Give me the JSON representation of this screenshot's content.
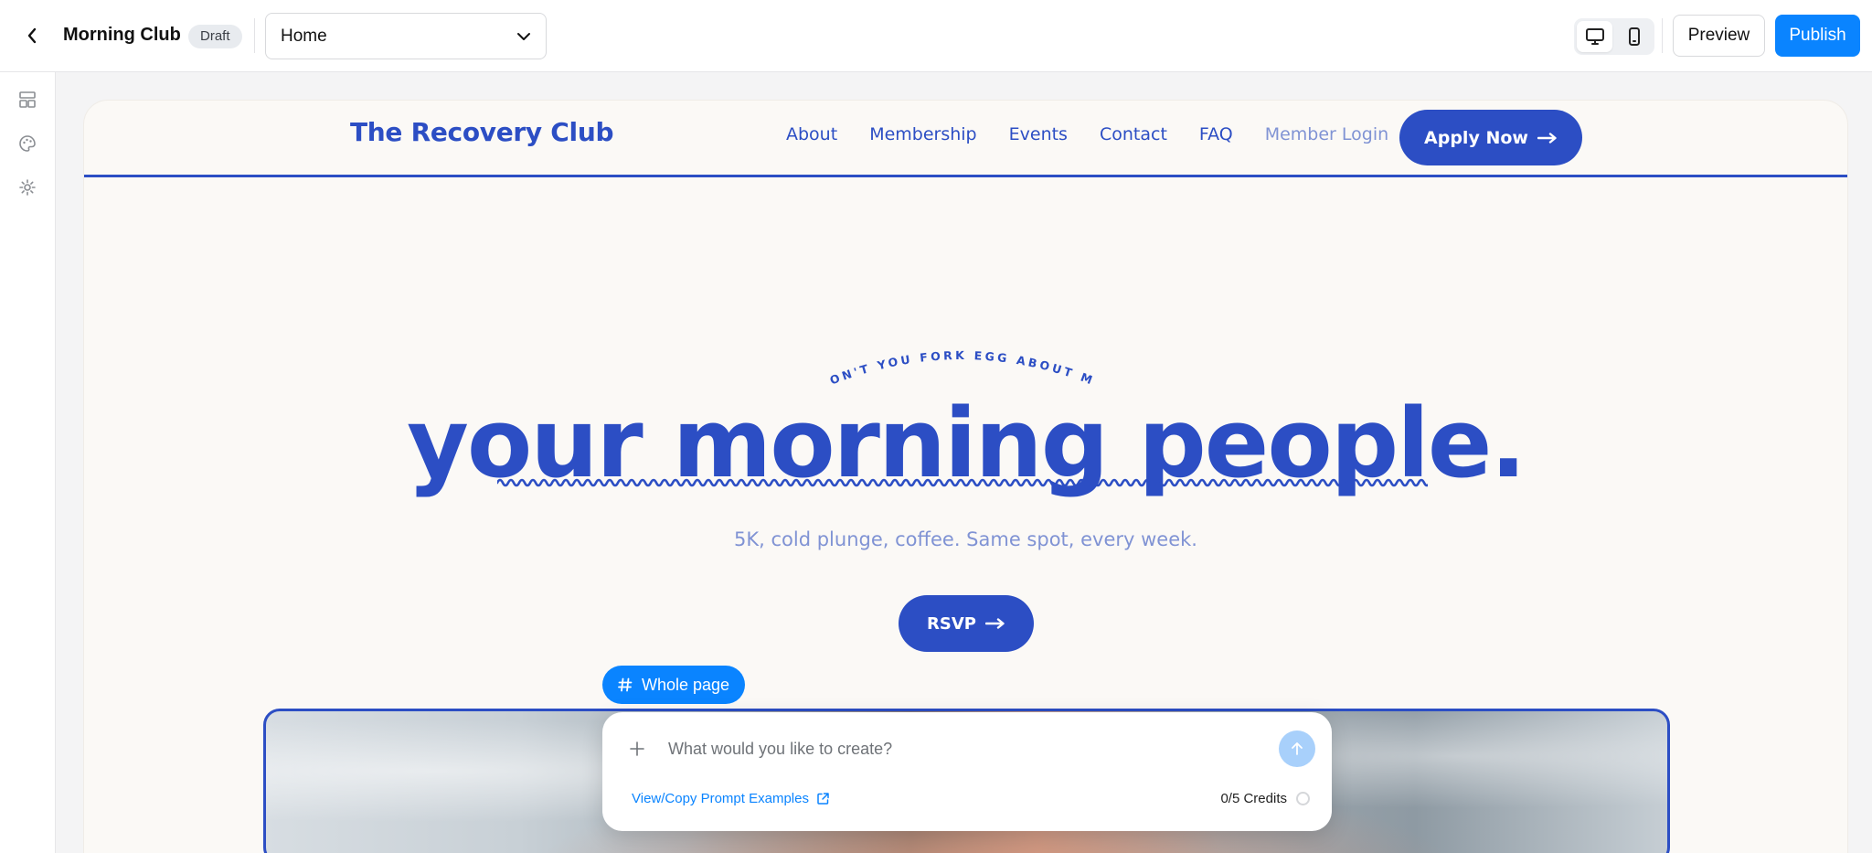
{
  "editor": {
    "site_name": "Morning Club",
    "status_badge": "Draft",
    "page_select": {
      "value": "Home"
    },
    "device_modes": [
      "desktop",
      "mobile"
    ],
    "active_device": "desktop",
    "preview_label": "Preview",
    "publish_label": "Publish",
    "accent_color": "#0a84ff"
  },
  "left_rail": {
    "items": [
      {
        "icon": "layout-icon"
      },
      {
        "icon": "palette-icon"
      },
      {
        "icon": "gear-icon"
      }
    ]
  },
  "site": {
    "brand": "The Recovery Club",
    "nav": [
      "About",
      "Membership",
      "Events",
      "Contact",
      "FAQ",
      "Member Login"
    ],
    "apply_label": "Apply Now",
    "hero": {
      "tagline": "DON'T YOU FORK EGG ABOUT ME",
      "title": "your morning people.",
      "subtitle": "5K, cold plunge, coffee. Same spot, every week.",
      "rsvp_label": "RSVP"
    },
    "brand_color": "#2c4ec4",
    "muted_color": "#8093d4",
    "background_color": "#fbf9f6"
  },
  "ai_prompt": {
    "scope_label": "Whole page",
    "placeholder": "What would you like to create?",
    "examples_link": "View/Copy Prompt Examples",
    "credits": "0/5 Credits"
  }
}
